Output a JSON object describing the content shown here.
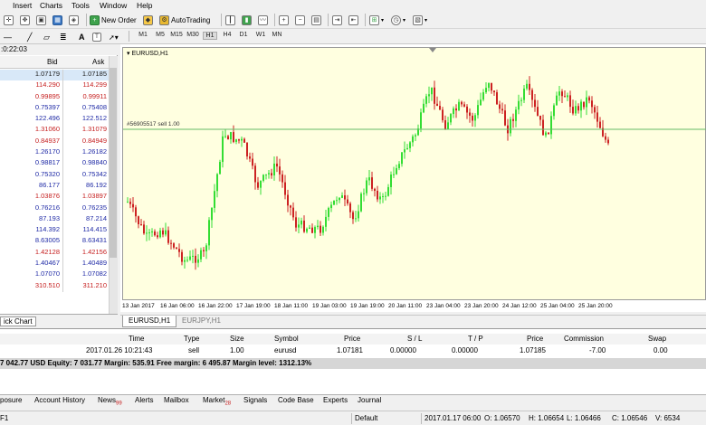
{
  "menu": {
    "items": [
      "Insert",
      "Charts",
      "Tools",
      "Window",
      "Help"
    ]
  },
  "toolbar": {
    "new_order_label": "New Order",
    "autotrading_label": "AutoTrading",
    "timeframes": [
      "M1",
      "M5",
      "M15",
      "M30",
      "H1",
      "H4",
      "D1",
      "W1",
      "MN"
    ],
    "active_timeframe": "H1"
  },
  "market_watch": {
    "time": ":0:22:03",
    "col_bid": "Bid",
    "col_ask": "Ask",
    "rows": [
      {
        "bid": "1.07179",
        "ask": "1.07185",
        "dir": "neutral"
      },
      {
        "bid": "114.290",
        "ask": "114.299",
        "dir": "down"
      },
      {
        "bid": "0.99895",
        "ask": "0.99911",
        "dir": "down"
      },
      {
        "bid": "0.75397",
        "ask": "0.75408",
        "dir": "up"
      },
      {
        "bid": "122.496",
        "ask": "122.512",
        "dir": "up"
      },
      {
        "bid": "1.31060",
        "ask": "1.31079",
        "dir": "down"
      },
      {
        "bid": "0.84937",
        "ask": "0.84949",
        "dir": "down"
      },
      {
        "bid": "1.26170",
        "ask": "1.26182",
        "dir": "up"
      },
      {
        "bid": "0.98817",
        "ask": "0.98840",
        "dir": "up"
      },
      {
        "bid": "0.75320",
        "ask": "0.75342",
        "dir": "up"
      },
      {
        "bid": "86.177",
        "ask": "86.192",
        "dir": "up"
      },
      {
        "bid": "1.03876",
        "ask": "1.03897",
        "dir": "down"
      },
      {
        "bid": "0.76216",
        "ask": "0.76235",
        "dir": "up"
      },
      {
        "bid": "87.193",
        "ask": "87.214",
        "dir": "up"
      },
      {
        "bid": "114.392",
        "ask": "114.415",
        "dir": "up"
      },
      {
        "bid": "8.63005",
        "ask": "8.63431",
        "dir": "up"
      },
      {
        "bid": "1.42128",
        "ask": "1.42156",
        "dir": "down"
      },
      {
        "bid": "1.40467",
        "ask": "1.40489",
        "dir": "up"
      },
      {
        "bid": "1.07070",
        "ask": "1.07082",
        "dir": "up"
      },
      {
        "bid": "310.510",
        "ask": "311.210",
        "dir": "down"
      }
    ],
    "tab_label": "ick Chart"
  },
  "chart": {
    "title": "EURUSD,H1",
    "order_line_label": "#56905517 sell 1.00",
    "x_labels": [
      "13 Jan 2017",
      "16 Jan 06:00",
      "16 Jan 22:00",
      "17 Jan 19:00",
      "18 Jan 11:00",
      "19 Jan 03:00",
      "19 Jan 19:00",
      "20 Jan 11:00",
      "23 Jan 04:00",
      "23 Jan 20:00",
      "24 Jan 12:00",
      "25 Jan 04:00",
      "25 Jan 20:00"
    ],
    "tabs": [
      "EURUSD,H1",
      "EURJPY,H1"
    ],
    "bull_color": "#33dd33",
    "bear_color": "#cc2222",
    "background": "#ffffe0",
    "order_line_color": "#66bb66"
  },
  "terminal": {
    "headers": [
      "Time",
      "Type",
      "Size",
      "Symbol",
      "Price",
      "S / L",
      "T / P",
      "Price",
      "Commission",
      "Swap"
    ],
    "row": [
      "2017.01.26 10:21:43",
      "sell",
      "1.00",
      "eurusd",
      "1.07181",
      "0.00000",
      "0.00000",
      "1.07185",
      "-7.00",
      "0.00"
    ],
    "summary": "7 042.77 USD  Equity: 7 031.77  Margin: 535.91  Free margin: 6 495.87  Margin level: 1312.13%"
  },
  "bottom_tabs": [
    {
      "label": "posure",
      "badge": ""
    },
    {
      "label": "Account History",
      "badge": ""
    },
    {
      "label": "News",
      "badge": "99"
    },
    {
      "label": "Alerts",
      "badge": ""
    },
    {
      "label": "Mailbox",
      "badge": ""
    },
    {
      "label": "Market",
      "badge": "28"
    },
    {
      "label": "Signals",
      "badge": ""
    },
    {
      "label": "Code Base",
      "badge": ""
    },
    {
      "label": "Experts",
      "badge": ""
    },
    {
      "label": "Journal",
      "badge": ""
    }
  ],
  "status": {
    "left": "F1",
    "profile": "Default",
    "time": "2017.01.17 06:00",
    "open": "O: 1.06570",
    "high": "H: 1.06654",
    "low": "L: 1.06466",
    "close": "C: 1.06546",
    "volume": "V: 6534"
  },
  "chart_data": {
    "type": "candlestick",
    "x_tick_labels": [
      "13 Jan 2017",
      "16 Jan 06:00",
      "16 Jan 22:00",
      "17 Jan 19:00",
      "18 Jan 11:00",
      "19 Jan 03:00",
      "19 Jan 19:00",
      "20 Jan 11:00",
      "23 Jan 04:00",
      "23 Jan 20:00",
      "24 Jan 12:00",
      "25 Jan 04:00",
      "25 Jan 20:00"
    ],
    "series": [
      {
        "symbol": "EURUSD",
        "timeframe": "H1"
      }
    ],
    "order_line": {
      "label": "#56905517 sell 1.00"
    },
    "grid": false
  }
}
